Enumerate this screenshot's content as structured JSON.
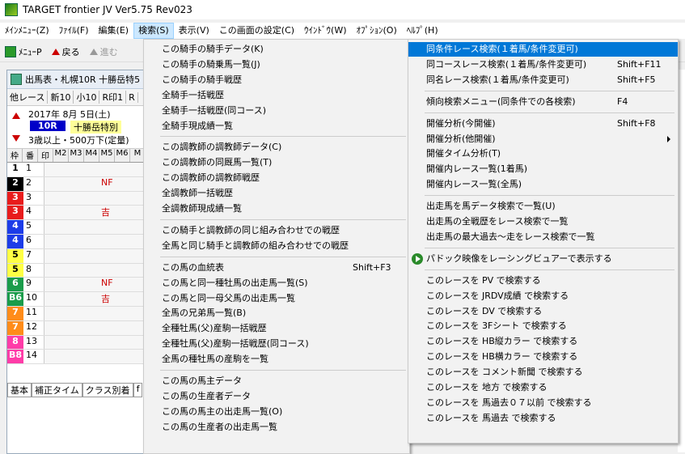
{
  "app": {
    "title": "TARGET frontier JV  Ver5.75  Rev023"
  },
  "menubar": [
    "ﾒｲﾝﾒﾆｭｰ(Z)",
    "ﾌｧｲﾙ(F)",
    "編集(E)",
    "検索(S)",
    "表示(V)",
    "この画面の設定(C)",
    "ｳｲﾝﾄﾞｳ(W)",
    "ｵﾌﾟｼｮﾝ(O)",
    "ﾍﾙﾌﾟ(H)"
  ],
  "toolbar": {
    "menu_p": "ﾒﾆｭｰP",
    "back": "戻る",
    "forward": "進む"
  },
  "child": {
    "title": "出馬表・札幌10R 十勝岳特5",
    "tabs": [
      "他レース",
      "新10",
      "小10",
      "R印1",
      "R"
    ],
    "date": "2017年  8月  5日(土)",
    "race_no": "10R",
    "race_name": "十勝岳特別",
    "conditions": "3歳以上・500万下(定量)",
    "grid_headers": [
      "枠",
      "番",
      "印",
      "M2",
      "M3",
      "M4",
      "M5",
      "M6",
      "M"
    ],
    "rows": [
      {
        "waku": "1",
        "uma": "1",
        "mark": "",
        "color": "#ffffff",
        "text": "#000000"
      },
      {
        "waku": "2",
        "uma": "2",
        "mark": "NF",
        "color": "#000000",
        "text": "#ffffff"
      },
      {
        "waku": "3",
        "uma": "3",
        "mark": "",
        "color": "#e81c1c",
        "text": "#ffffff"
      },
      {
        "waku": "3",
        "uma": "4",
        "mark": "吉",
        "color": "#e81c1c",
        "text": "#ffffff"
      },
      {
        "waku": "4",
        "uma": "5",
        "mark": "",
        "color": "#1c3ce8",
        "text": "#ffffff"
      },
      {
        "waku": "4",
        "uma": "6",
        "mark": "",
        "color": "#1c3ce8",
        "text": "#ffffff"
      },
      {
        "waku": "5",
        "uma": "7",
        "mark": "",
        "color": "#ffff44",
        "text": "#000000"
      },
      {
        "waku": "5",
        "uma": "8",
        "mark": "",
        "color": "#ffff44",
        "text": "#000000"
      },
      {
        "waku": "6",
        "uma": "9",
        "mark": "NF",
        "color": "#1a9c4a",
        "text": "#ffffff"
      },
      {
        "waku": "B6",
        "uma": "10",
        "mark": "吉",
        "color": "#1a9c4a",
        "text": "#ffffff"
      },
      {
        "waku": "7",
        "uma": "11",
        "mark": "",
        "color": "#ff8c1a",
        "text": "#ffffff"
      },
      {
        "waku": "7",
        "uma": "12",
        "mark": "",
        "color": "#ff8c1a",
        "text": "#ffffff"
      },
      {
        "waku": "8",
        "uma": "13",
        "mark": "",
        "color": "#ff3ca8",
        "text": "#ffffff"
      },
      {
        "waku": "B8",
        "uma": "14",
        "mark": "",
        "color": "#ff3ca8",
        "text": "#ffffff"
      }
    ],
    "bottom_tabs": [
      "基本",
      "補正タイム",
      "クラス別着",
      "f"
    ]
  },
  "menu_left": {
    "groups": [
      [
        "この騎手の騎手データ(K)",
        "この騎手の騎乗馬一覧(J)",
        "この騎手の騎手戦歴",
        "全騎手一括戦歴",
        "全騎手一括戦歴(同コース)",
        "全騎手現成績一覧"
      ],
      [
        "この調教師の調教師データ(C)",
        "この調教師の同厩馬一覧(T)",
        "この調教師の調教師戦歴",
        "全調教師一括戦歴",
        "全調教師現成績一覧"
      ],
      [
        "この騎手と調教師の同じ組み合わせでの戦歴",
        "全馬と同じ騎手と調教師の組み合わせでの戦歴"
      ],
      [
        "この馬の血統表",
        "この馬と同一種牡馬の出走馬一覧(S)",
        "この馬と同一母父馬の出走馬一覧",
        "全馬の兄弟馬一覧(B)",
        "全種牡馬(父)産駒一括戦歴",
        "全種牡馬(父)産駒一括戦歴(同コース)",
        "全馬の種牡馬の産駒を一覧"
      ],
      [
        "この馬の馬主データ",
        "この馬の生産者データ",
        "この馬の馬主の出走馬一覧(O)",
        "この馬の生産者の出走馬一覧"
      ]
    ],
    "shortcut_bloodline": "Shift+F3"
  },
  "menu_right": {
    "groups": [
      [
        "同条件レース検索(１着馬/条件変更可)",
        "同コースレース検索(１着馬/条件変更可)",
        "同名レース検索(１着馬/条件変更可)"
      ],
      [
        "傾向検索メニュー(同条件での各検索)"
      ],
      [
        "開催分析(今開催)",
        "開催分析(他開催)",
        "開催タイム分析(T)",
        "開催内レース一覧(1着馬)",
        "開催内レース一覧(全馬)"
      ],
      [
        "出走馬を馬データ検索で一覧(U)",
        "出走馬の全戦歴をレース検索で一覧",
        "出走馬の最大過去～走をレース検索で一覧"
      ],
      [
        "パドック映像をレーシングビュアーで表示する"
      ],
      [
        "このレースを PV で検索する",
        "このレースを JRDV成績 で検索する",
        "このレースを DV で検索する",
        "このレースを 3Fシート で検索する",
        "このレースを HB縦カラー で検索する",
        "このレースを HB横カラー で検索する",
        "このレースを コメント新聞 で検索する",
        "このレースを 地方 で検索する",
        "このレースを 馬過去０７以前 で検索する",
        "このレースを 馬過去 で検索する"
      ]
    ],
    "shortcuts": {
      "same_course": "Shift+F11",
      "same_name": "Shift+F5",
      "trend": "F4",
      "kaisai_now": "Shift+F8"
    }
  }
}
